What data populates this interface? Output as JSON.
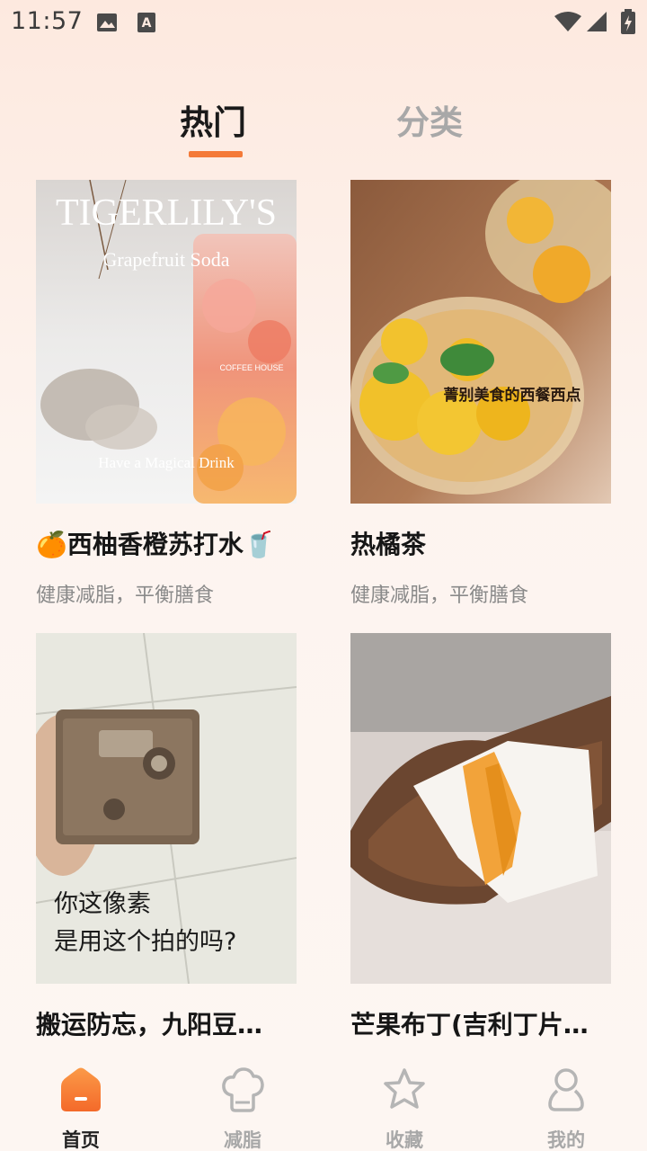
{
  "status_bar": {
    "time": "11:57",
    "icons": [
      "image-icon",
      "text-a-icon",
      "wifi-icon",
      "signal-icon",
      "battery-charging-icon"
    ]
  },
  "tabs": [
    {
      "label": "热门",
      "active": true
    },
    {
      "label": "分类",
      "active": false
    }
  ],
  "accent_color": "#f47a38",
  "cards": [
    {
      "title": "🍊西柚香橙苏打水🥤",
      "subtitle": "健康减脂，平衡膳食",
      "image_text": {
        "headline": "TIGERLILY'S",
        "sub": "Grapefruit Soda",
        "bottom": "Have a Magical Drink",
        "cup": "COFFEE HOUSE"
      }
    },
    {
      "title": "热橘茶",
      "subtitle": "健康减脂，平衡膳食",
      "image_text": {
        "watermark": "菁别美食的西餐西点"
      }
    },
    {
      "title": "搬运防忘，九阳豆…",
      "subtitle": "",
      "image_text": {
        "line1": "你这像素",
        "line2": "是用这个拍的吗?"
      }
    },
    {
      "title": "芒果布丁(吉利丁片…",
      "subtitle": "",
      "image_text": {}
    }
  ],
  "bottom_nav": [
    {
      "label": "首页",
      "icon": "home-icon",
      "active": true
    },
    {
      "label": "减脂",
      "icon": "chef-hat-icon",
      "active": false
    },
    {
      "label": "收藏",
      "icon": "star-icon",
      "active": false
    },
    {
      "label": "我的",
      "icon": "person-icon",
      "active": false
    }
  ]
}
